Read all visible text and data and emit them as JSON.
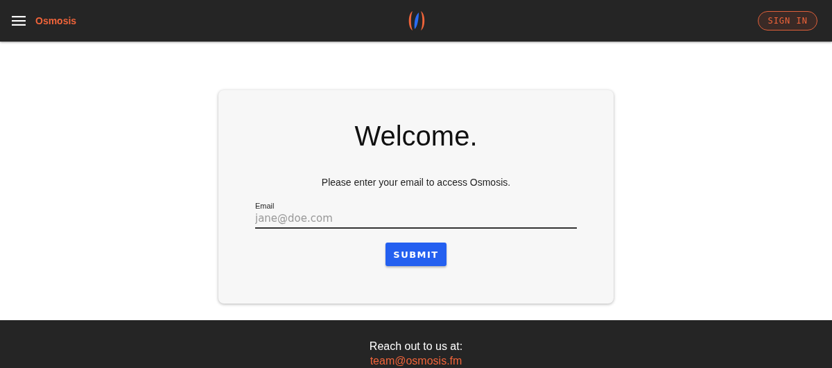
{
  "header": {
    "brand": "Osmosis",
    "sign_in": "SIGN IN"
  },
  "card": {
    "title": "Welcome.",
    "message": "Please enter your email to access Osmosis.",
    "email_field": {
      "label": "Email",
      "placeholder": "jane@doe.com"
    },
    "submit": "SUBMIT"
  },
  "footer": {
    "text": "Reach out to us at:",
    "email": "team@osmosis.fm"
  }
}
